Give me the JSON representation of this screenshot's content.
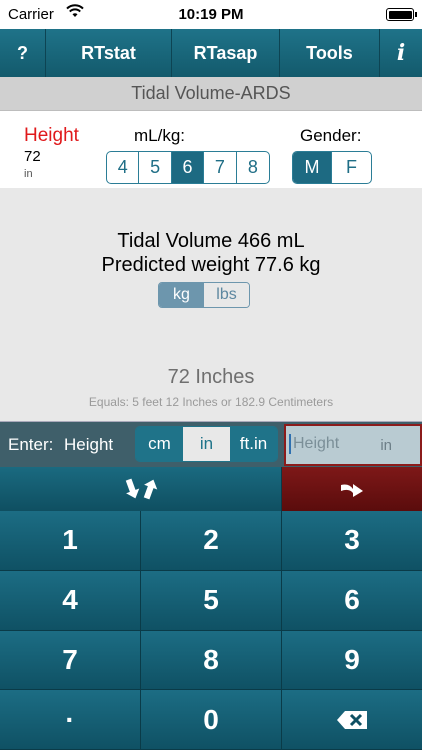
{
  "status_bar": {
    "carrier": "Carrier",
    "time": "10:19 PM"
  },
  "nav": {
    "help": "?",
    "rtstat": "RTstat",
    "rtasap": "RTasap",
    "tools": "Tools",
    "info": "i"
  },
  "title": "Tidal Volume-ARDS",
  "height": {
    "label": "Height",
    "value": "72",
    "unit": "in"
  },
  "mlkg": {
    "label": "mL/kg:",
    "options": [
      "4",
      "5",
      "6",
      "7",
      "8"
    ],
    "selected": "6"
  },
  "gender": {
    "label": "Gender:",
    "options": [
      "M",
      "F"
    ],
    "selected": "M"
  },
  "result": {
    "tidal_volume": "Tidal Volume  466 mL",
    "predicted_weight": "Predicted weight 77.6 kg"
  },
  "weight_unit": {
    "options": [
      "kg",
      "lbs"
    ],
    "selected": "kg"
  },
  "conversion": {
    "inches": "72 Inches",
    "equals": "Equals: 5 feet 12 Inches or 182.9 Centimeters"
  },
  "entry": {
    "label": "Enter:",
    "field_name": "Height",
    "unit_options": [
      "cm",
      "in",
      "ft.in"
    ],
    "unit_selected": "in",
    "placeholder": "Height",
    "field_unit": "in"
  },
  "keypad": {
    "keys": [
      "1",
      "2",
      "3",
      "4",
      "5",
      "6",
      "7",
      "8",
      "9",
      "·",
      "0"
    ]
  },
  "colors": {
    "accent": "#1f7389",
    "height_label": "#e0191b",
    "next_button": "#7e1818"
  }
}
